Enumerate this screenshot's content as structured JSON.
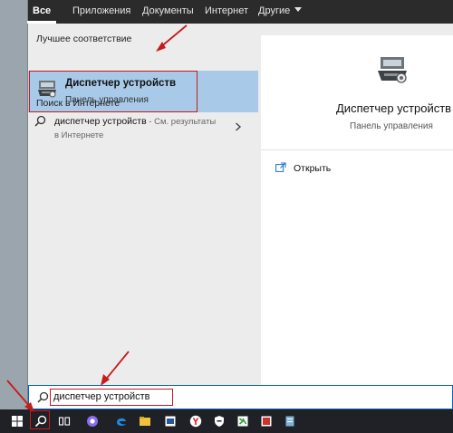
{
  "tabs": {
    "all": "Все",
    "apps": "Приложения",
    "documents": "Документы",
    "internet": "Интернет",
    "other": "Другие"
  },
  "left": {
    "best_match_header": "Лучшее соответствие",
    "best_match": {
      "title": "Диспетчер устройств",
      "subtitle": "Панель управления"
    },
    "web_header": "Поиск в Интернете",
    "web_result": {
      "query": "диспетчер устройств",
      "hint_line1": " - См. результаты",
      "hint_line2": "в Интернете"
    }
  },
  "preview": {
    "title": "Диспетчер устройств",
    "subtitle": "Панель управления",
    "open_label": "Открыть"
  },
  "search": {
    "value": "диспетчер устройств"
  },
  "colors": {
    "highlight": "#a9c9e8",
    "annotation": "#c81a1a",
    "taskbar": "#1f2127",
    "tab_bar": "#2b2b2b"
  },
  "taskbar_icons": [
    "windows-start-icon",
    "search-icon",
    "task-view-icon",
    "cortana-icon",
    "edge-icon",
    "file-explorer-icon",
    "word-icon",
    "yandex-icon",
    "shield-icon",
    "app-green-icon",
    "app-red-icon",
    "notes-icon"
  ]
}
